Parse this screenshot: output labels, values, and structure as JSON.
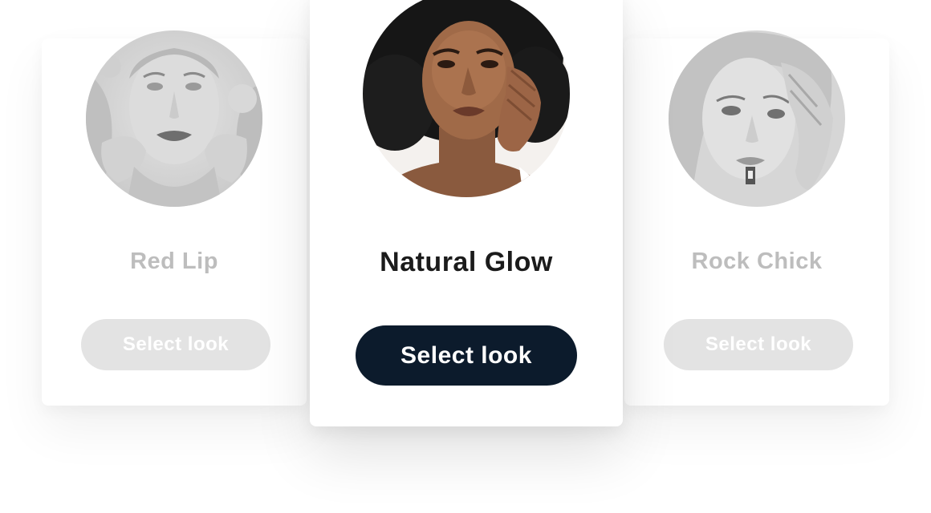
{
  "looks": [
    {
      "title": "Red Lip",
      "button_label": "Select look",
      "state": "inactive",
      "photo": "grayscale-portrait-with-flowers"
    },
    {
      "title": "Natural Glow",
      "button_label": "Select look",
      "state": "active",
      "photo": "color-portrait-natural-hair"
    },
    {
      "title": "Rock Chick",
      "button_label": "Select look",
      "state": "inactive",
      "photo": "grayscale-portrait-hand-on-head"
    }
  ],
  "colors": {
    "active_button": "#0c1b2c",
    "inactive_button": "#e3e3e3",
    "active_title": "#1b1b1b",
    "inactive_title": "#bdbdbd"
  }
}
